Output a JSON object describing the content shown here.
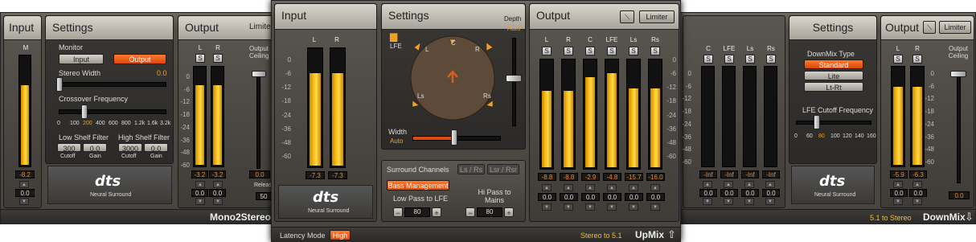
{
  "mono": {
    "input_title": "Input",
    "settings_title": "Settings",
    "output_title": "Output",
    "limiter_label": "Limiter",
    "channel_m": "M",
    "monitor_label": "Monitor",
    "monitor_input": "Input",
    "monitor_output": "Output",
    "stereo_width_label": "Stereo Width",
    "stereo_width_value": "0.0",
    "crossover_label": "Crossover Frequency",
    "crossover_ticks": [
      "0",
      "100",
      "200",
      "400",
      "600",
      "800",
      "1.2k",
      "1.6k",
      "3.2k"
    ],
    "low_shelf_label": "Low Shelf Filter",
    "high_shelf_label": "High Shelf Filter",
    "low_cutoff": "300",
    "low_gain": "0.0",
    "high_cutoff": "3000",
    "high_gain": "0.0",
    "cutoff_label": "Cutoff",
    "gain_label": "Gain",
    "input_peak": "-8.2",
    "input_trim": "0.0",
    "out_l": "L",
    "out_r": "R",
    "out_s": "S",
    "out_peak_l": "-3.2",
    "out_peak_r": "-3.2",
    "out_trim_l": "0.0",
    "out_trim_r": "0.0",
    "output_ceiling_label": "Output Ceiling",
    "ceiling_value": "0.0",
    "release_label": "Release",
    "release_value": "50",
    "neural_surround": "Neural Surround",
    "dts": "dts",
    "name": "Mono2Stereo",
    "scale": [
      "0",
      "-6",
      "-12",
      "-18",
      "-24",
      "-36",
      "-48",
      "-60"
    ],
    "input_level": 0.72,
    "out_levels": [
      0.8,
      0.8
    ]
  },
  "upmix": {
    "input_title": "Input",
    "settings_title": "Settings",
    "output_title": "Output",
    "limiter_label": "Limiter",
    "in_channels": [
      "L",
      "R"
    ],
    "in_peaks": [
      "-7.3",
      "-7.3"
    ],
    "in_levels": [
      0.78,
      0.78
    ],
    "scale": [
      "0",
      "-6",
      "-12",
      "-18",
      "-24",
      "-36",
      "-48",
      "-60"
    ],
    "lfe_label": "LFE",
    "depth_label": "Depth",
    "depth_value": "Auto",
    "width_label": "Width",
    "width_value": "Auto",
    "speaker_labels": [
      "L",
      "C",
      "R",
      "Ls",
      "Rs"
    ],
    "surround_channels_label": "Surround Channels",
    "surround_opt1": "Ls / Rs",
    "surround_opt2": "Lsr / Rsr",
    "bass_management": "Bass Management",
    "low_pass_label": "Low Pass to LFE",
    "hi_pass_label": "Hi Pass to Mains",
    "low_pass_value": "80",
    "hi_pass_value": "80",
    "minus": "−",
    "plus": "+",
    "out_channels": [
      "L",
      "R",
      "C",
      "LFE",
      "Ls",
      "Rs"
    ],
    "out_peaks": [
      "-8.8",
      "-8.8",
      "-2.9",
      "-4.8",
      "-15.7",
      "-16.0"
    ],
    "out_levels": [
      0.7,
      0.7,
      0.82,
      0.86,
      0.72,
      0.72
    ],
    "out_trims": [
      "0.0",
      "0.0",
      "0.0",
      "0.0",
      "0.0",
      "0.0"
    ],
    "s_label": "S",
    "neural_surround": "Neural Surround",
    "dts": "dts",
    "latency_label": "Latency Mode",
    "latency_value": "High",
    "subtitle": "Stereo to 5.1",
    "name": "UpMix"
  },
  "downmix": {
    "settings_title": "Settings",
    "output_title": "Output",
    "limiter_label": "Limiter",
    "in_channels": [
      "C",
      "LFE",
      "Ls",
      "Rs"
    ],
    "in_peaks": [
      "-Inf",
      "-Inf",
      "-Inf",
      "-Inf"
    ],
    "in_trims": [
      "0.0",
      "0.0",
      "0.0",
      "0.0"
    ],
    "scale": [
      "0",
      "-6",
      "-12",
      "-18",
      "-24",
      "-36",
      "-48",
      "-60"
    ],
    "downmix_type_label": "DownMix Type",
    "type_standard": "Standard",
    "type_lite": "Lite",
    "type_ltrt": "Lt-Rt",
    "lfe_cutoff_label": "LFE Cutoff Frequency",
    "lfe_ticks": [
      "0",
      "60",
      "80",
      "100",
      "120",
      "140",
      "160"
    ],
    "out_channels": [
      "L",
      "R"
    ],
    "out_peaks": [
      "-5.9",
      "-6.3"
    ],
    "out_trims": [
      "0.0",
      "0.0"
    ],
    "out_levels": [
      0.78,
      0.78
    ],
    "output_ceiling_label": "Output Ceiling",
    "ceiling_value": "0.0",
    "s_label": "S",
    "neural_surround": "Neural Surround",
    "dts": "dts",
    "subtitle": "5.1 to Stereo",
    "name": "DownMix"
  }
}
